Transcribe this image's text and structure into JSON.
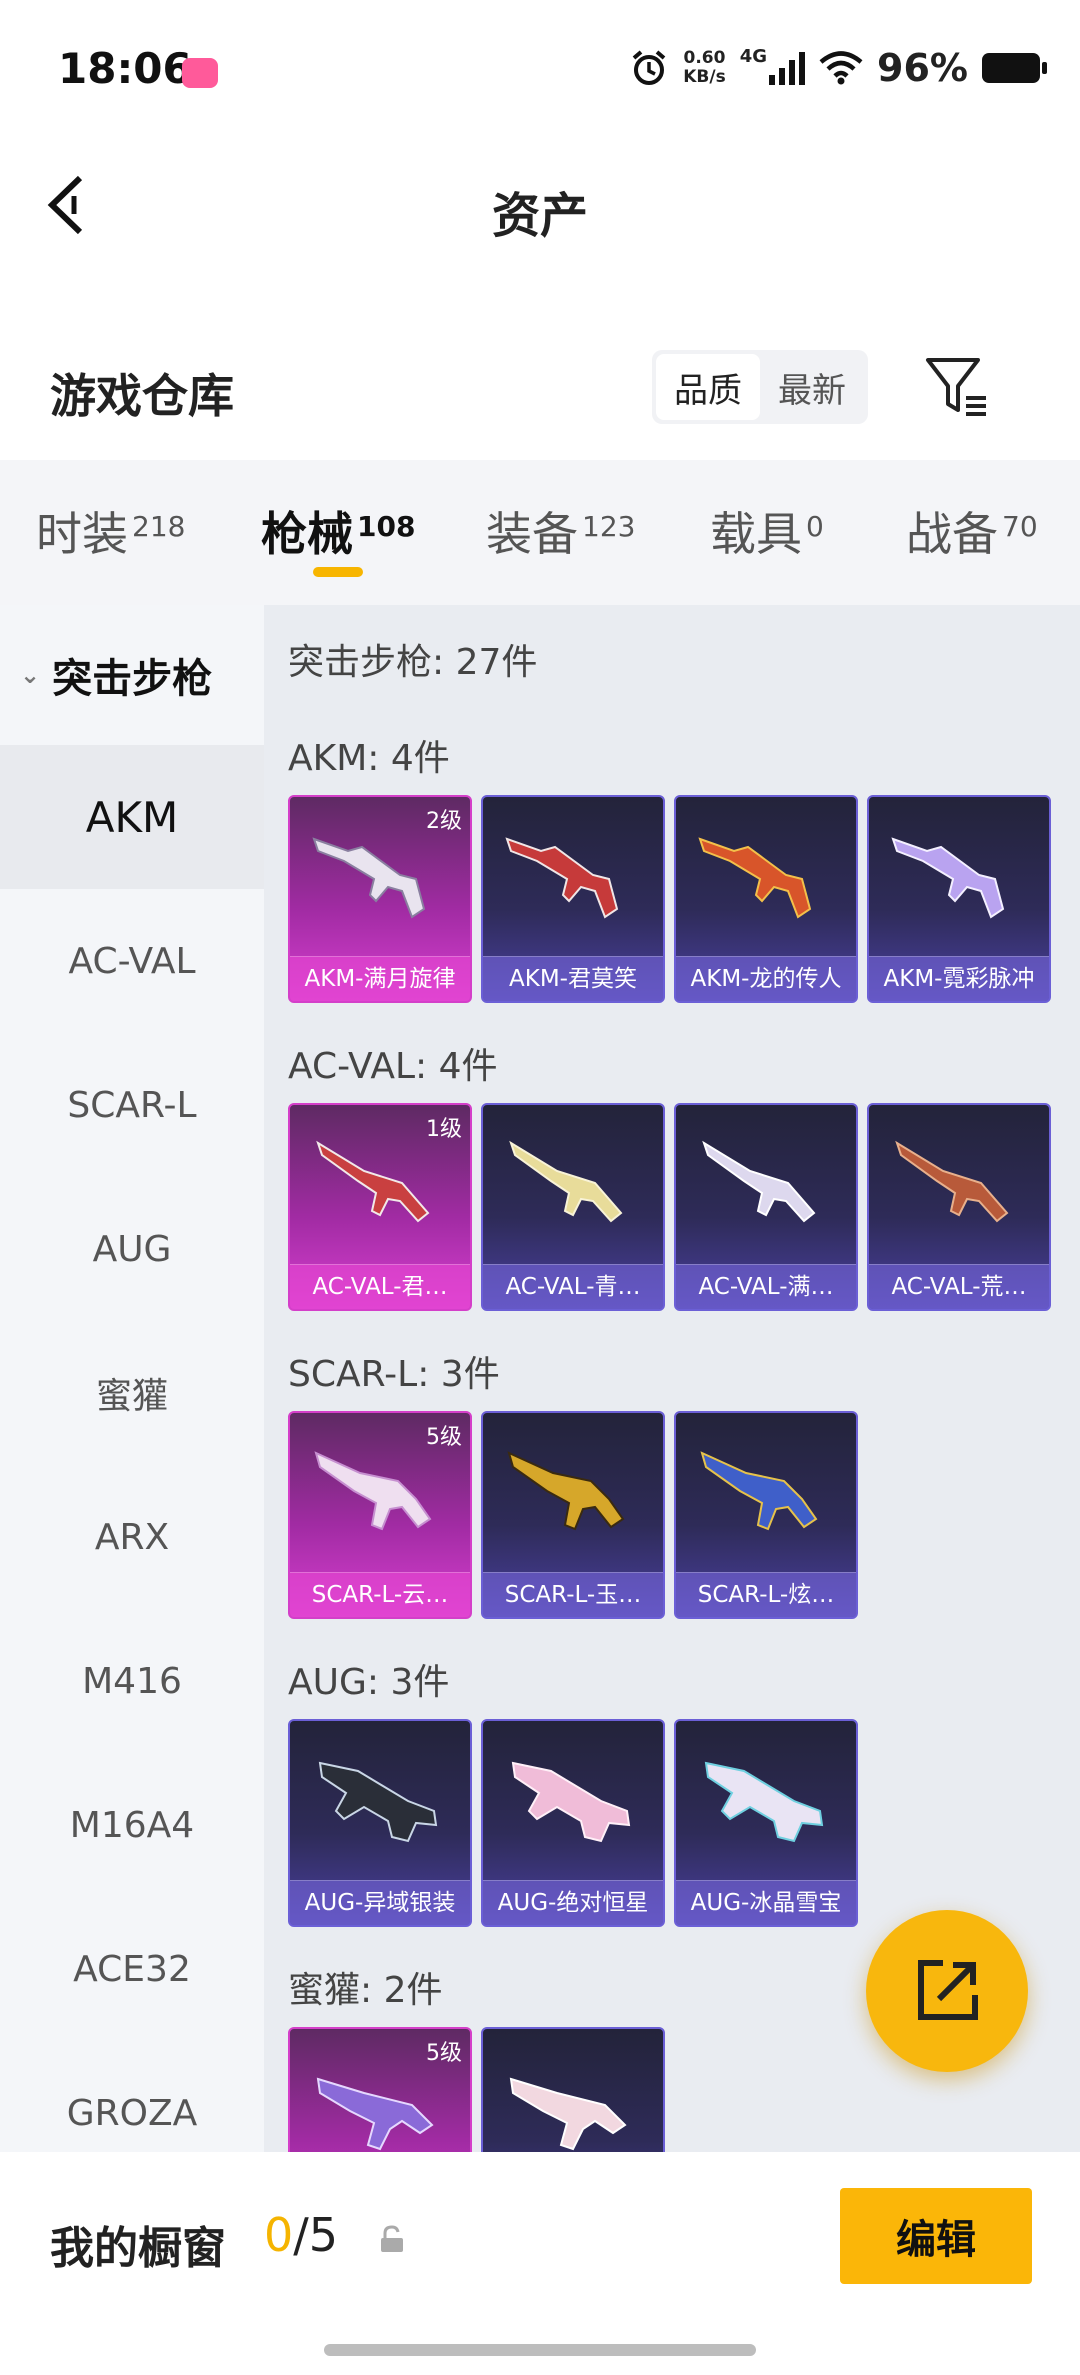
{
  "status": {
    "time": "18:06",
    "net_speed_value": "0.60",
    "net_speed_unit": "KB/s",
    "network": "4G",
    "battery": "96%"
  },
  "header": {
    "title": "资产"
  },
  "section": {
    "title": "游戏仓库",
    "sort_quality": "品质",
    "sort_newest": "最新"
  },
  "tabs": [
    {
      "label": "时装",
      "count": "218"
    },
    {
      "label": "枪械",
      "count": "108"
    },
    {
      "label": "装备",
      "count": "123"
    },
    {
      "label": "载具",
      "count": "0"
    },
    {
      "label": "战备",
      "count": "70"
    }
  ],
  "sidebar": {
    "category": "突击步枪",
    "items": [
      "AKM",
      "AC-VAL",
      "SCAR-L",
      "AUG",
      "蜜獾",
      "ARX",
      "M416",
      "M16A4",
      "ACE32",
      "GROZA"
    ]
  },
  "content": {
    "summary": "突击步枪: 27件",
    "groups": [
      {
        "title": "AKM: 4件",
        "items": [
          {
            "name": "AKM-满月旋律",
            "level": "2级"
          },
          {
            "name": "AKM-君莫笑"
          },
          {
            "name": "AKM-龙的传人"
          },
          {
            "name": "AKM-霓彩脉冲"
          }
        ]
      },
      {
        "title": "AC-VAL: 4件",
        "items": [
          {
            "name": "AC-VAL-君…",
            "level": "1级"
          },
          {
            "name": "AC-VAL-青…"
          },
          {
            "name": "AC-VAL-满…"
          },
          {
            "name": "AC-VAL-荒…"
          }
        ]
      },
      {
        "title": "SCAR-L: 3件",
        "items": [
          {
            "name": "SCAR-L-云…",
            "level": "5级"
          },
          {
            "name": "SCAR-L-玉…"
          },
          {
            "name": "SCAR-L-炫…"
          }
        ]
      },
      {
        "title": "AUG: 3件",
        "items": [
          {
            "name": "AUG-异域银装"
          },
          {
            "name": "AUG-绝对恒星"
          },
          {
            "name": "AUG-冰晶雪宝"
          }
        ]
      },
      {
        "title": "蜜獾: 2件",
        "items": [
          {
            "name": "",
            "level": "5级"
          },
          {
            "name": ""
          }
        ]
      }
    ]
  },
  "showcase": {
    "title": "我的橱窗",
    "current": "0",
    "max": "/5",
    "edit_label": "编辑"
  },
  "colors": {
    "accent": "#f7b500",
    "card_pink": "#d43fc9",
    "card_purple": "#6b5fd6"
  }
}
